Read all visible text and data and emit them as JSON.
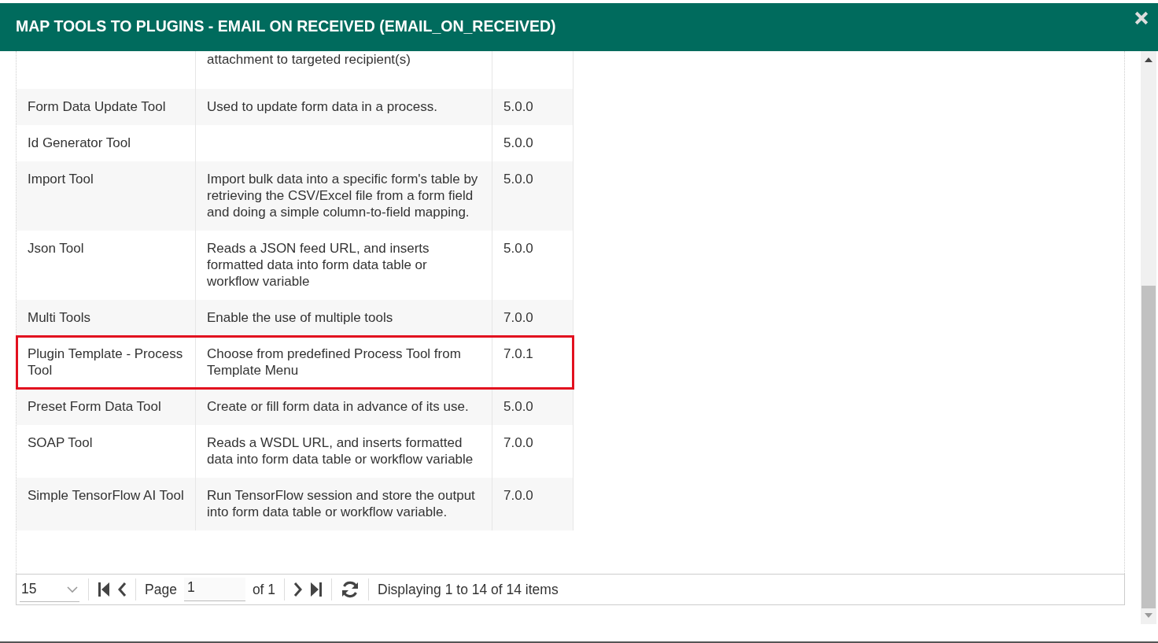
{
  "window": {
    "title": "MAP TOOLS TO PLUGINS - EMAIL ON RECEIVED (EMAIL_ON_RECEIVED)"
  },
  "table": {
    "rows": [
      {
        "name": "",
        "description": "attachment to targeted recipient(s)",
        "version": "",
        "highlighted": false
      },
      {
        "name": "Form Data Update Tool",
        "description": "Used to update form data in a process.",
        "version": "5.0.0",
        "highlighted": false
      },
      {
        "name": "Id Generator Tool",
        "description": "",
        "version": "5.0.0",
        "highlighted": false
      },
      {
        "name": "Import Tool",
        "description": "Import bulk data into a specific form's table by retrieving the CSV/Excel file from a form field and doing a simple column-to-field mapping.",
        "version": "5.0.0",
        "highlighted": false
      },
      {
        "name": "Json Tool",
        "description": "Reads a JSON feed URL, and inserts formatted data into form data table or workflow variable",
        "version": "5.0.0",
        "highlighted": false
      },
      {
        "name": "Multi Tools",
        "description": "Enable the use of multiple tools",
        "version": "7.0.0",
        "highlighted": false
      },
      {
        "name": "Plugin Template - Process Tool",
        "description": "Choose from predefined Process Tool from Template Menu",
        "version": "7.0.1",
        "highlighted": true
      },
      {
        "name": "Preset Form Data Tool",
        "description": "Create or fill form data in advance of its use.",
        "version": "5.0.0",
        "highlighted": false
      },
      {
        "name": "SOAP Tool",
        "description": "Reads a WSDL URL, and inserts formatted data into form data table or workflow variable",
        "version": "7.0.0",
        "highlighted": false
      },
      {
        "name": "Simple TensorFlow AI Tool",
        "description": "Run TensorFlow session and store the output into form data table or workflow variable.",
        "version": "7.0.0",
        "highlighted": false
      }
    ]
  },
  "pager": {
    "page_size": "15",
    "page_label": "Page",
    "page": "1",
    "of": "of 1",
    "summary": "Displaying 1 to 14 of 14 items"
  }
}
